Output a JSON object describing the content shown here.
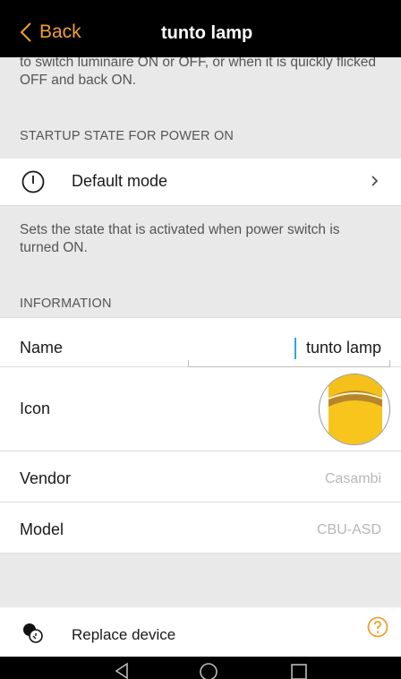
{
  "header": {
    "back_label": "Back",
    "title": "tunto lamp"
  },
  "top_description": "to switch luminaire ON or OFF, or when it is quickly flicked OFF and back ON.",
  "startup": {
    "header": "STARTUP STATE FOR POWER ON",
    "mode_label": "Default mode",
    "description": "Sets the state that is activated when power switch is turned ON."
  },
  "information": {
    "header": "INFORMATION",
    "name_label": "Name",
    "name_value": "tunto lamp",
    "icon_label": "Icon",
    "vendor_label": "Vendor",
    "vendor_value": "Casambi",
    "model_label": "Model",
    "model_value": "CBU-ASD"
  },
  "replace": {
    "label": "Replace device"
  },
  "colors": {
    "accent": "#f0a030",
    "lamp_yellow": "#f7c51c",
    "cursor": "#2aa8d8"
  },
  "icons": [
    "chevron-left-icon",
    "power-icon",
    "chevron-right-icon",
    "lamp-icon",
    "replace-device-icon",
    "help-icon",
    "nav-back-icon",
    "nav-home-icon",
    "nav-recents-icon"
  ]
}
